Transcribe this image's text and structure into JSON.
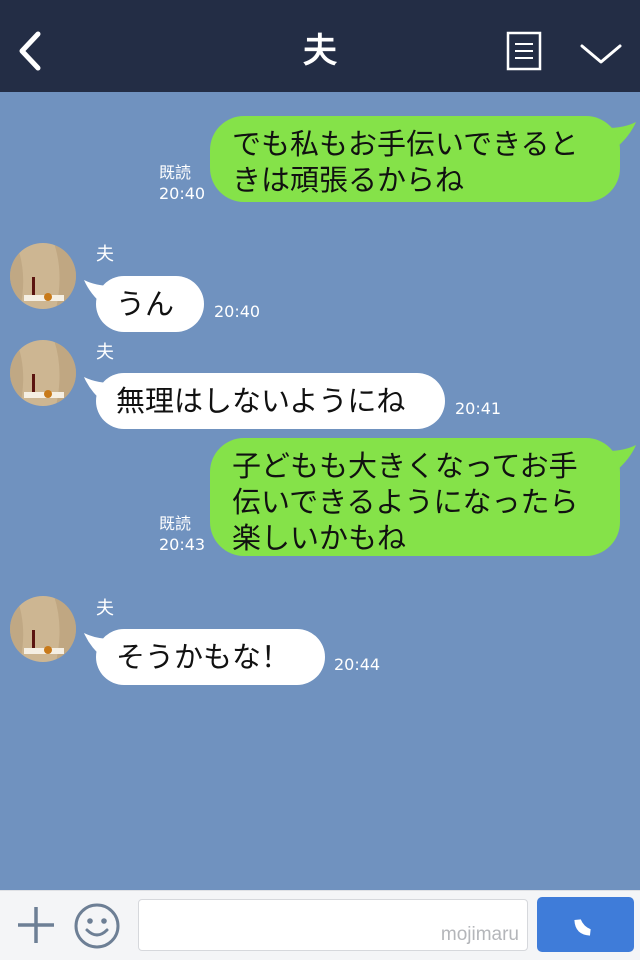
{
  "header": {
    "title": "夫",
    "back_icon": "chevron-left-icon",
    "menu_icon": "notes-icon",
    "expand_icon": "chevron-down-icon"
  },
  "messages": [
    {
      "direction": "sent",
      "text": "でも私もお手伝いできると\nきは頑張るからね",
      "read_label": "既読",
      "time": "20:40"
    },
    {
      "direction": "received",
      "sender": "夫",
      "text": "うん",
      "time": "20:40"
    },
    {
      "direction": "received",
      "sender": "夫",
      "text": "無理はしないようにね",
      "time": "20:41"
    },
    {
      "direction": "sent",
      "text": "子どもも大きくなってお手\n伝いできるようになったら\n楽しいかもね",
      "read_label": "既読",
      "time": "20:43"
    },
    {
      "direction": "received",
      "sender": "夫",
      "text": "そうかもな！",
      "time": "20:44"
    }
  ],
  "input_bar": {
    "plus_icon": "plus-icon",
    "emoji_icon": "smiley-icon",
    "call_icon": "phone-icon",
    "watermark": "mojimaru"
  },
  "colors": {
    "header_bg": "#232d45",
    "chat_bg": "#7092bf",
    "sent_bubble": "#85e249",
    "received_bubble": "#ffffff",
    "call_button": "#3f7cd9"
  }
}
